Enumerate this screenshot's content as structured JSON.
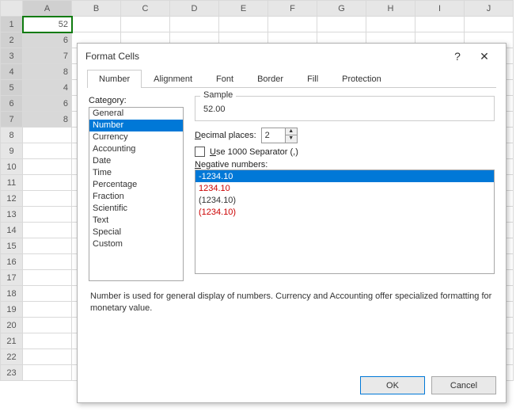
{
  "sheet": {
    "columns": [
      "A",
      "B",
      "C",
      "D",
      "E",
      "F",
      "G",
      "H",
      "I",
      "J"
    ],
    "rows": 23,
    "active_cell": {
      "row": 1,
      "col": 1
    },
    "selection": {
      "from": {
        "row": 1,
        "col": 1
      },
      "to": {
        "row": 7,
        "col": 1
      }
    },
    "cells": {
      "A1": "52",
      "A2": "6",
      "A3": "7",
      "A4": "8",
      "A5": "4",
      "A6": "6",
      "A7": "8"
    }
  },
  "dialog": {
    "title": "Format Cells",
    "help_glyph": "?",
    "close_glyph": "✕",
    "tabs": [
      "Number",
      "Alignment",
      "Font",
      "Border",
      "Fill",
      "Protection"
    ],
    "active_tab": 0,
    "category_label": "Category:",
    "categories": [
      "General",
      "Number",
      "Currency",
      "Accounting",
      "Date",
      "Time",
      "Percentage",
      "Fraction",
      "Scientific",
      "Text",
      "Special",
      "Custom"
    ],
    "selected_category": 1,
    "sample_label": "Sample",
    "sample_value": "52.00",
    "decimal_label_pre": "D",
    "decimal_label_rest": "ecimal places:",
    "decimal_value": "2",
    "separator_label_pre": "U",
    "separator_label_rest": "se 1000 Separator (,)",
    "separator_checked": false,
    "negative_label_pre": "N",
    "negative_label_rest": "egative numbers:",
    "negative_options": [
      {
        "text": "-1234.10",
        "style": "normal"
      },
      {
        "text": "1234.10",
        "style": "red"
      },
      {
        "text": "(1234.10)",
        "style": "normal"
      },
      {
        "text": "(1234.10)",
        "style": "red"
      }
    ],
    "selected_negative": 0,
    "description": "Number is used for general display of numbers.  Currency and Accounting offer specialized formatting for monetary value.",
    "ok_label": "OK",
    "cancel_label": "Cancel"
  }
}
